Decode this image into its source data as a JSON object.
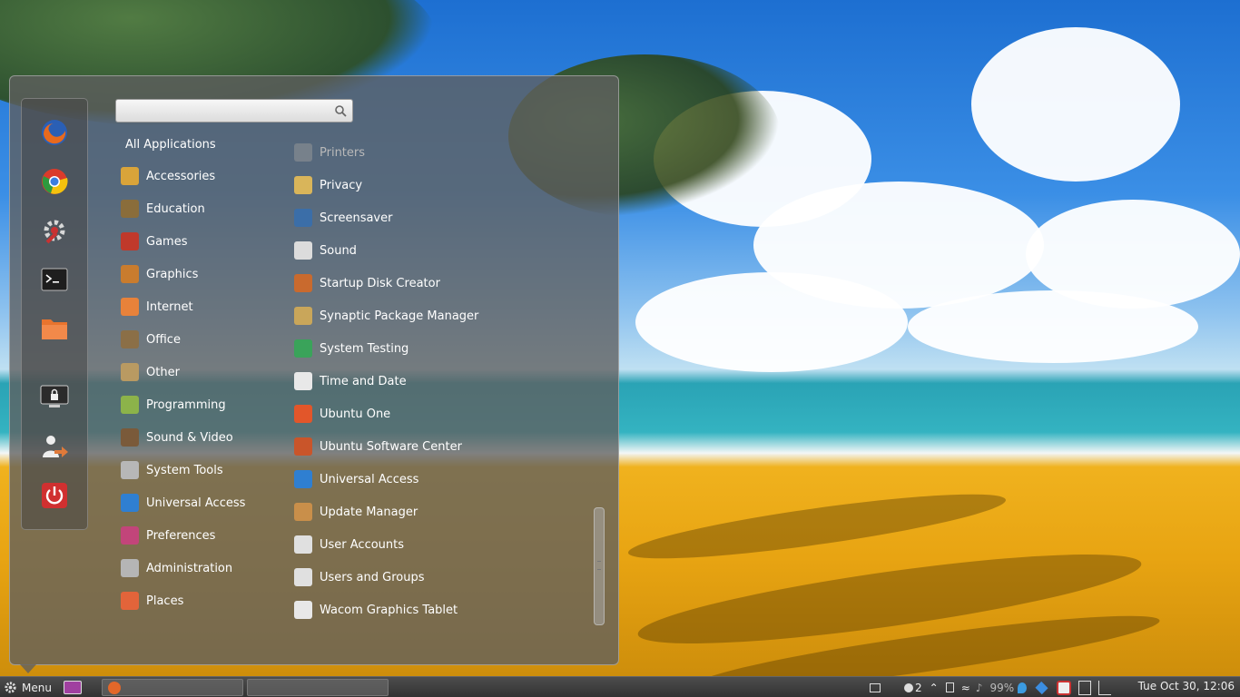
{
  "search": {
    "value": "",
    "placeholder": ""
  },
  "categories": {
    "all": "All Applications",
    "items": [
      {
        "label": "Accessories",
        "icon": "accessories-icon",
        "color": "#d9a43a"
      },
      {
        "label": "Education",
        "icon": "education-icon",
        "color": "#8a6d3b"
      },
      {
        "label": "Games",
        "icon": "games-icon",
        "color": "#c0392b"
      },
      {
        "label": "Graphics",
        "icon": "graphics-icon",
        "color": "#c97c2e"
      },
      {
        "label": "Internet",
        "icon": "internet-icon",
        "color": "#e8823a"
      },
      {
        "label": "Office",
        "icon": "office-icon",
        "color": "#8b6f47"
      },
      {
        "label": "Other",
        "icon": "other-icon",
        "color": "#b99a62"
      },
      {
        "label": "Programming",
        "icon": "programming-icon",
        "color": "#8cb34a"
      },
      {
        "label": "Sound & Video",
        "icon": "sound-video-icon",
        "color": "#7a5a3a"
      },
      {
        "label": "System Tools",
        "icon": "system-tools-icon",
        "color": "#b7b7b7"
      },
      {
        "label": "Universal Access",
        "icon": "universal-access-icon",
        "color": "#2f7fd1"
      },
      {
        "label": "Preferences",
        "icon": "preferences-icon",
        "color": "#c2457a"
      },
      {
        "label": "Administration",
        "icon": "administration-icon",
        "color": "#b5b5b5"
      },
      {
        "label": "Places",
        "icon": "places-icon",
        "color": "#e2643a"
      }
    ]
  },
  "apps": [
    {
      "label": "Printers",
      "icon": "printer-icon",
      "color": "#9a9a9a"
    },
    {
      "label": "Privacy",
      "icon": "privacy-icon",
      "color": "#d9b55a"
    },
    {
      "label": "Screensaver",
      "icon": "screensaver-icon",
      "color": "#3b6ea8"
    },
    {
      "label": "Sound",
      "icon": "sound-icon",
      "color": "#dcdcdc"
    },
    {
      "label": "Startup Disk Creator",
      "icon": "startup-disk-creator-icon",
      "color": "#c96a2e"
    },
    {
      "label": "Synaptic Package Manager",
      "icon": "synaptic-icon",
      "color": "#c9a65a"
    },
    {
      "label": "System Testing",
      "icon": "system-testing-icon",
      "color": "#3aa35a"
    },
    {
      "label": "Time and Date",
      "icon": "time-date-icon",
      "color": "#e8e8e8"
    },
    {
      "label": "Ubuntu One",
      "icon": "ubuntu-one-icon",
      "color": "#e2562a"
    },
    {
      "label": "Ubuntu Software Center",
      "icon": "software-center-icon",
      "color": "#c9552a"
    },
    {
      "label": "Universal Access",
      "icon": "universal-access-icon",
      "color": "#2f7fd1"
    },
    {
      "label": "Update Manager",
      "icon": "update-manager-icon",
      "color": "#c98f4a"
    },
    {
      "label": "User Accounts",
      "icon": "user-accounts-icon",
      "color": "#e0e0e0"
    },
    {
      "label": "Users and Groups",
      "icon": "users-groups-icon",
      "color": "#e0e0e0"
    },
    {
      "label": "Wacom Graphics Tablet",
      "icon": "wacom-icon",
      "color": "#e8e8e8"
    }
  ],
  "favorites": [
    {
      "name": "firefox-icon",
      "color": "#e2672a"
    },
    {
      "name": "chrome-icon",
      "color": "#3b8d3b"
    },
    {
      "name": "settings-icon",
      "color": "#c83232"
    },
    {
      "name": "terminal-icon",
      "color": "#222222"
    },
    {
      "name": "home-folder-icon",
      "color": "#e8742e"
    },
    {
      "name": "lock-screen-icon",
      "color": "#2b2b2b"
    },
    {
      "name": "logout-icon",
      "color": "#e07a3a"
    },
    {
      "name": "power-icon",
      "color": "#d03030"
    }
  ],
  "taskbar": {
    "menu_label": "Menu",
    "workspace": "2",
    "battery": "99%",
    "clock": "Tue Oct 30, 12:06"
  }
}
